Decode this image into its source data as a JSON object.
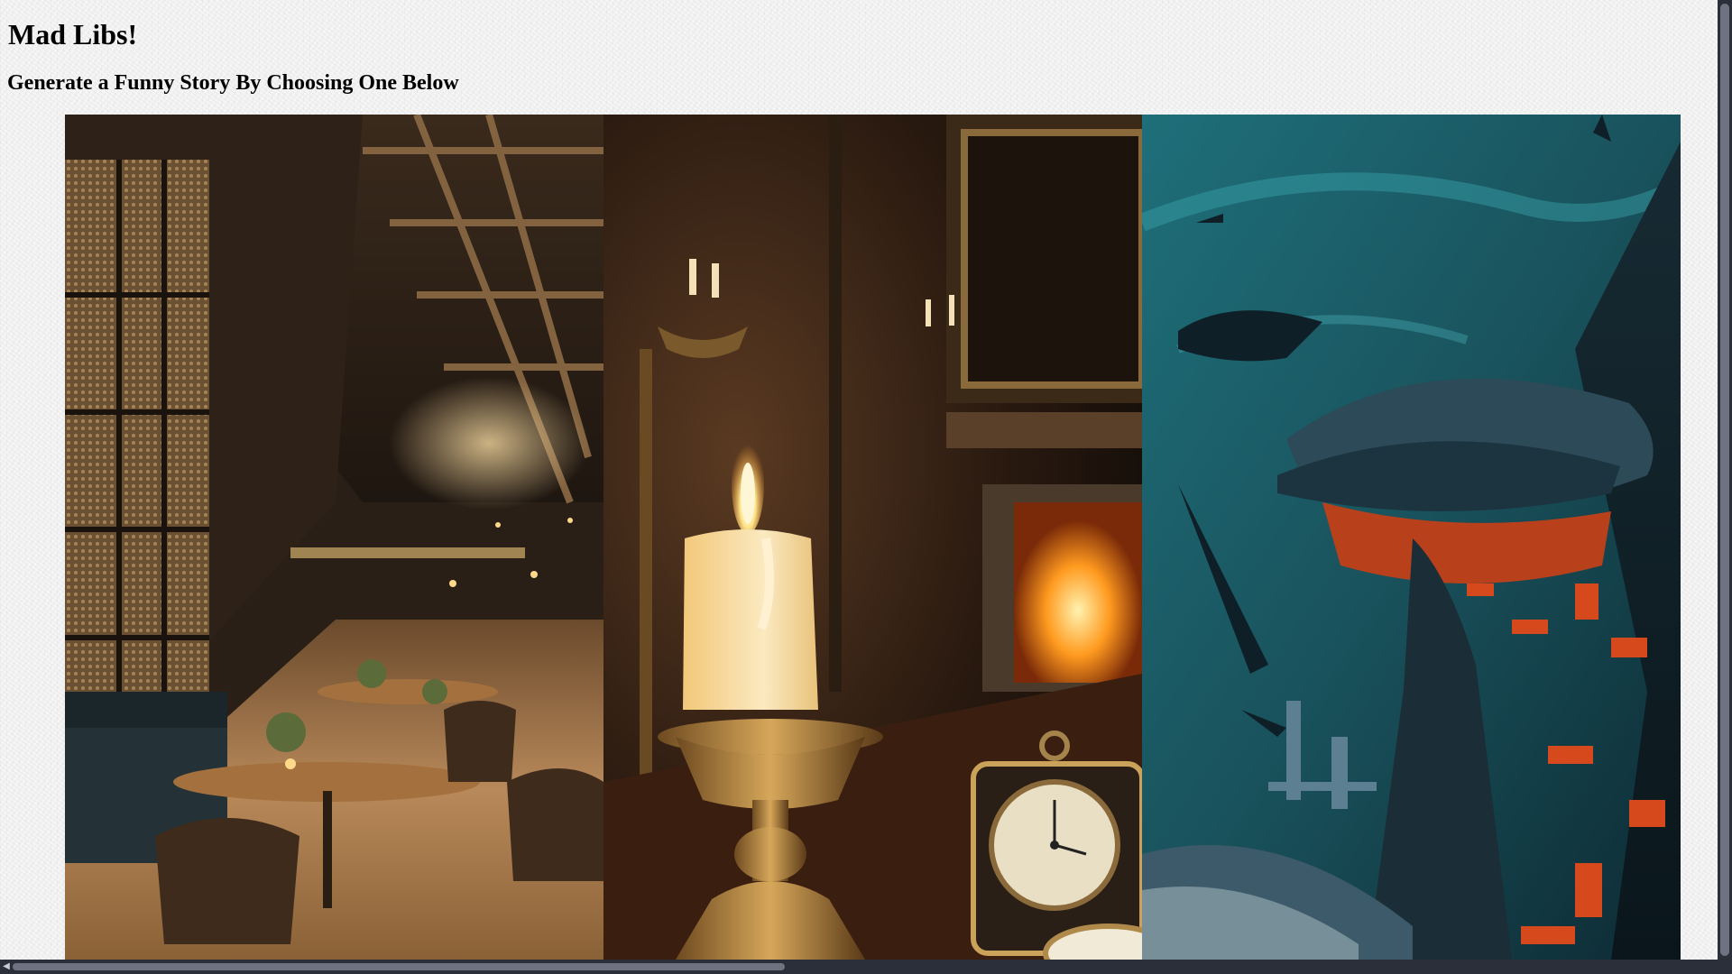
{
  "header": {
    "title": "Mad Libs!",
    "subtitle": "Generate a Funny Story By Choosing One Below"
  },
  "gallery": {
    "cards": [
      {
        "id": "restaurant",
        "depicts": "restaurant"
      },
      {
        "id": "candle",
        "depicts": "candle-and-pocket-watch"
      },
      {
        "id": "space",
        "depicts": "spaceship-wreck"
      }
    ]
  },
  "scrollbar": {
    "left_arrow_glyph": "◀"
  },
  "colors": {
    "page_background": "#f2f2f2",
    "scrollbar_track": "#2b2f3a",
    "scrollbar_thumb": "#6e7382"
  }
}
